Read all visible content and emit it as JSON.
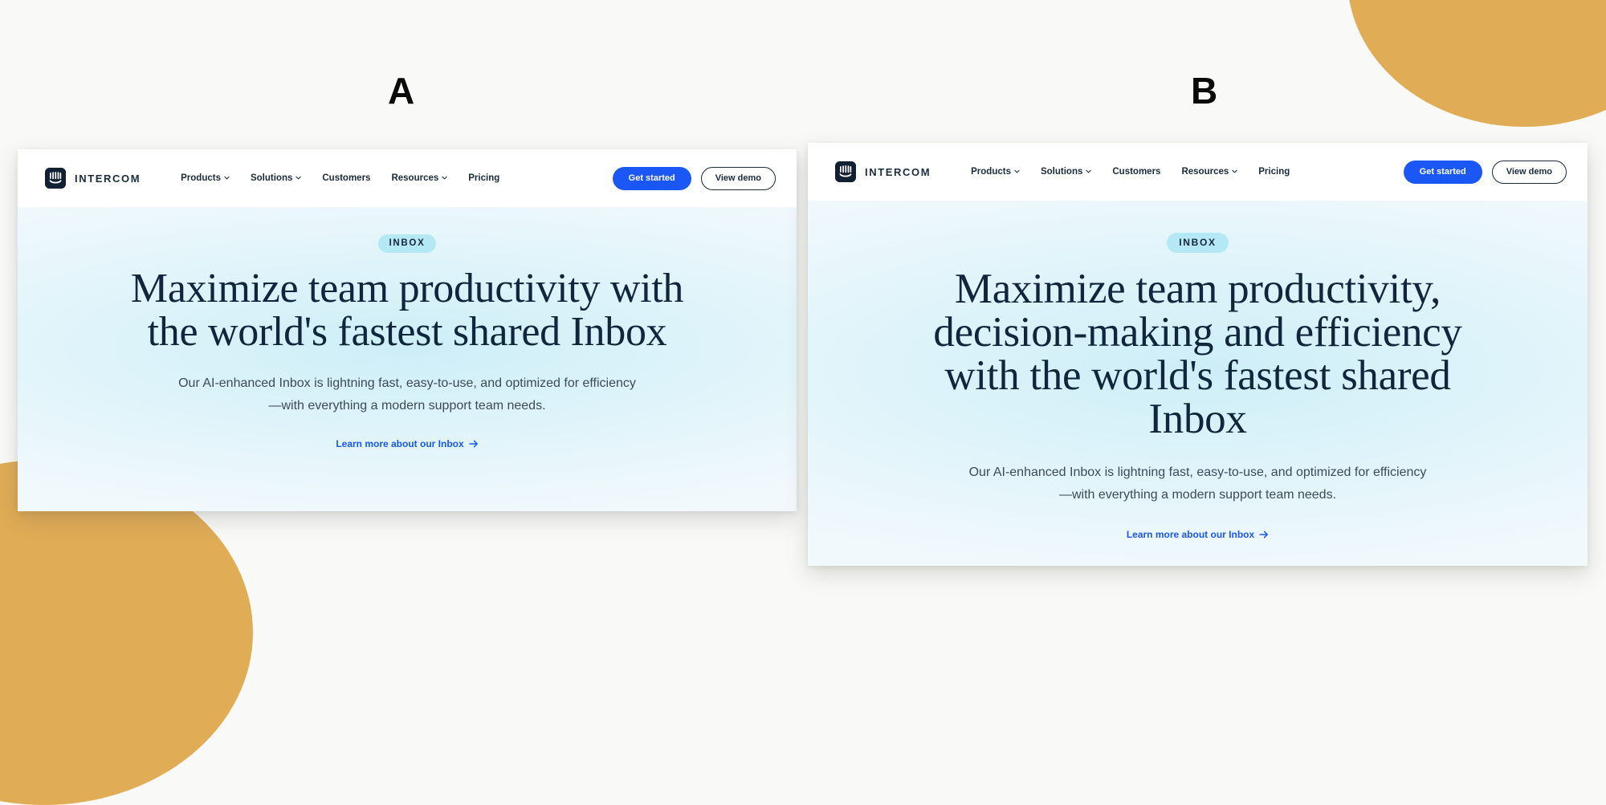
{
  "canvas": {
    "background_color": "#f9f9f7",
    "accent_shape_color": "#e0ac56"
  },
  "variants": [
    {
      "key": "a",
      "label": "A",
      "nav": {
        "brand_name": "INTERCOM",
        "logo_icon": "intercom-logo-icon",
        "links": [
          {
            "label": "Products",
            "has_dropdown": true
          },
          {
            "label": "Solutions",
            "has_dropdown": true
          },
          {
            "label": "Customers",
            "has_dropdown": false
          },
          {
            "label": "Resources",
            "has_dropdown": true
          },
          {
            "label": "Pricing",
            "has_dropdown": false
          }
        ],
        "primary_cta": "Get started",
        "secondary_cta": "View demo"
      },
      "hero": {
        "badge": "INBOX",
        "title": "Maximize team productivity with the world's fastest shared Inbox",
        "subtitle": "Our AI-enhanced Inbox is lightning fast, easy-to-use, and optimized for efficiency—with everything a modern support team needs.",
        "link_label": "Learn more about our Inbox",
        "link_arrow_icon": "arrow-right-icon"
      }
    },
    {
      "key": "b",
      "label": "B",
      "nav": {
        "brand_name": "INTERCOM",
        "logo_icon": "intercom-logo-icon",
        "links": [
          {
            "label": "Products",
            "has_dropdown": true
          },
          {
            "label": "Solutions",
            "has_dropdown": true
          },
          {
            "label": "Customers",
            "has_dropdown": false
          },
          {
            "label": "Resources",
            "has_dropdown": true
          },
          {
            "label": "Pricing",
            "has_dropdown": false
          }
        ],
        "primary_cta": "Get started",
        "secondary_cta": "View demo"
      },
      "hero": {
        "badge": "INBOX",
        "title": "Maximize team productivity, decision-making and efficiency with the world's fastest shared Inbox",
        "subtitle": "Our AI-enhanced Inbox is lightning fast, easy-to-use, and optimized for efficiency—with everything a modern support team needs.",
        "link_label": "Learn more about our Inbox",
        "link_arrow_icon": "arrow-right-icon"
      }
    }
  ],
  "colors": {
    "primary_button": "#1a57f5",
    "link": "#1a57f5",
    "badge_background": "#b5e8f5",
    "heading": "#10263c",
    "brand_dark": "#122034"
  }
}
